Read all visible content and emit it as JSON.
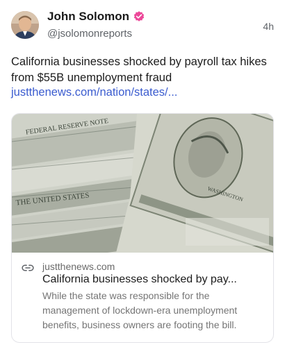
{
  "author": {
    "name": "John Solomon",
    "handle": "@jsolomonreports",
    "verified": true,
    "avatar_icon": "profile-photo"
  },
  "post": {
    "time": "4h",
    "text": "California businesses shocked by payroll tax hikes from $55B unemployment fraud",
    "link_text": "justthenews.com/nation/states/..."
  },
  "card": {
    "image_icon": "money-photo",
    "domain": "justthenews.com",
    "title": "California businesses shocked by pay...",
    "description": "While the state was responsible for the management of lockdown-era unemployment benefits, business owners are footing the bill."
  },
  "colors": {
    "accent": "#3b5ccf",
    "verified_badge": "#ec4899",
    "secondary_text": "#5f6368"
  }
}
